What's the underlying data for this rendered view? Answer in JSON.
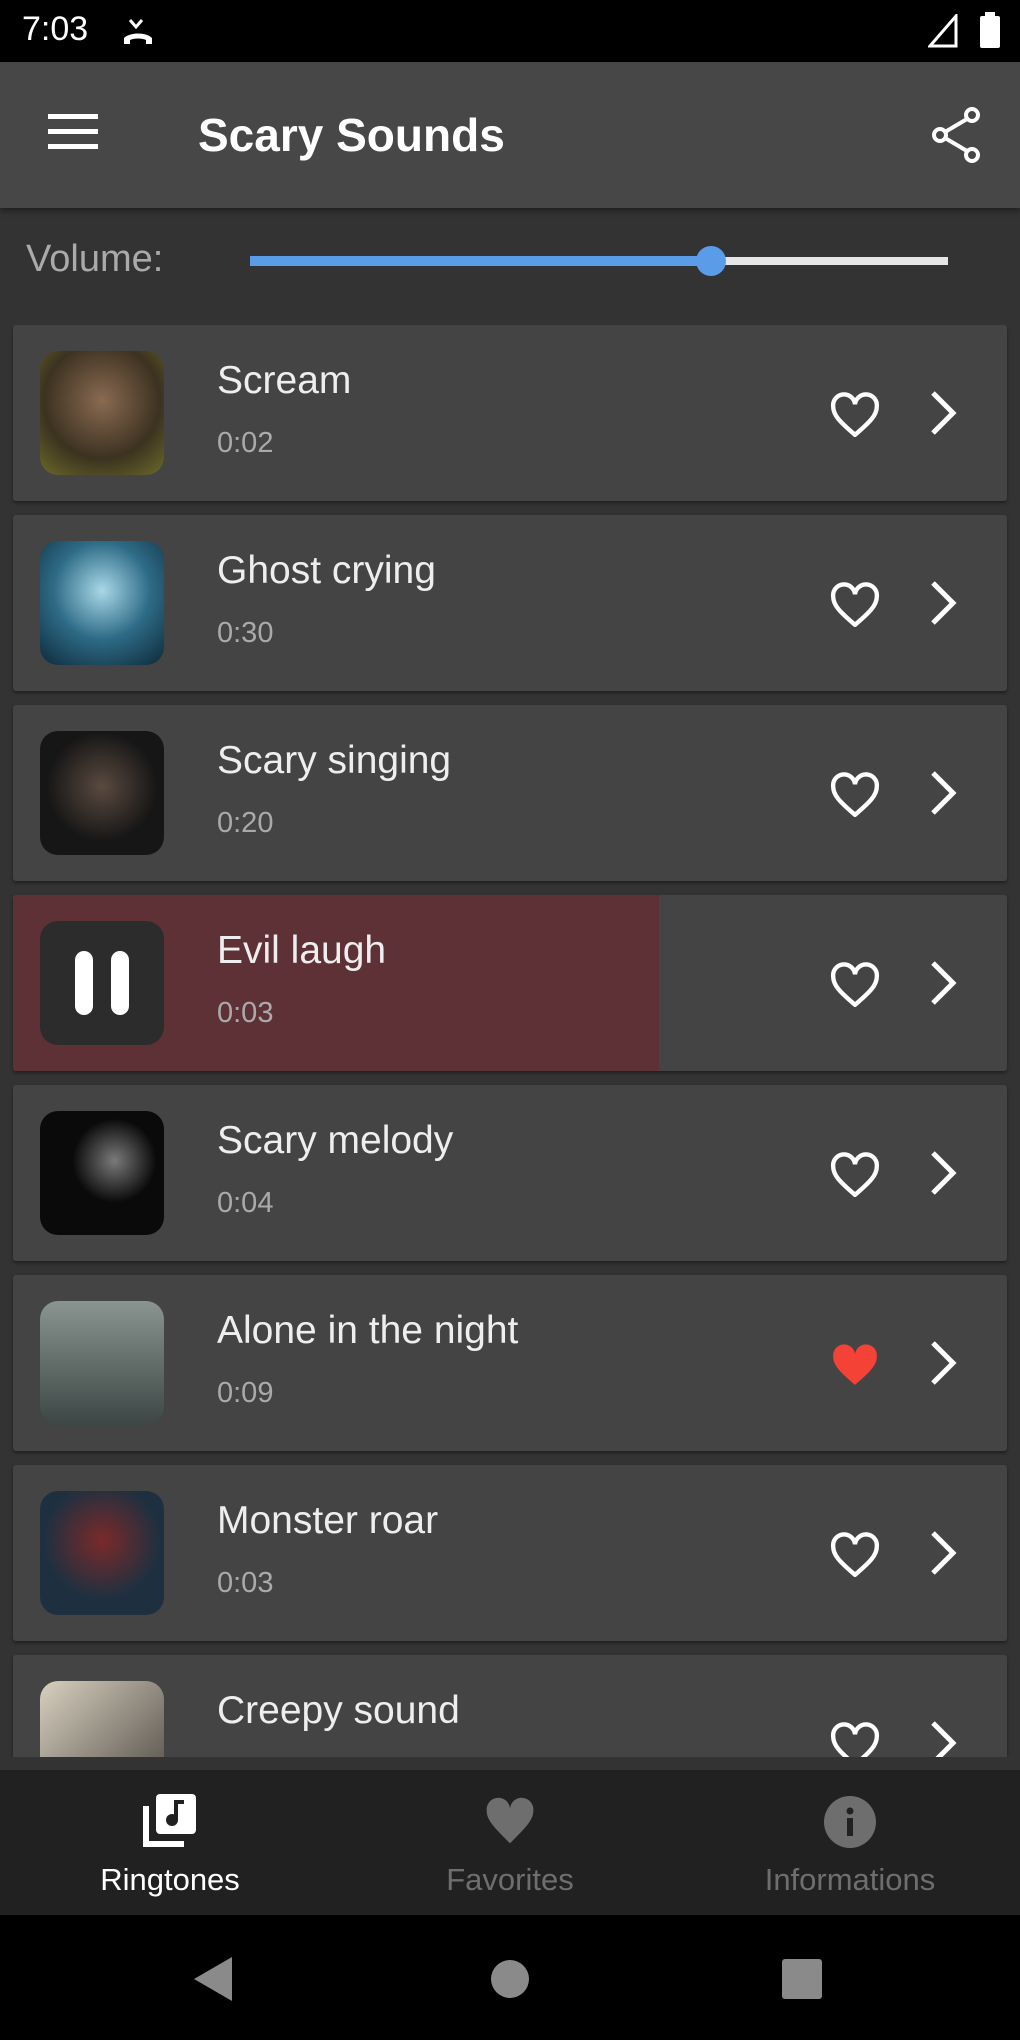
{
  "status_bar": {
    "time": "7:03"
  },
  "app_bar": {
    "title": "Scary Sounds",
    "menu_icon": "menu-icon",
    "share_icon": "share-icon"
  },
  "volume": {
    "label": "Volume:",
    "level": 0.66,
    "color": "#5b9ce8"
  },
  "sounds": [
    {
      "name": "Scream",
      "duration": "0:02",
      "favorite": false,
      "playing": false
    },
    {
      "name": "Ghost crying",
      "duration": "0:30",
      "favorite": false,
      "playing": false
    },
    {
      "name": "Scary singing",
      "duration": "0:20",
      "favorite": false,
      "playing": false
    },
    {
      "name": "Evil laugh",
      "duration": "0:03",
      "favorite": false,
      "playing": true,
      "progress": 0.65
    },
    {
      "name": "Scary melody",
      "duration": "0:04",
      "favorite": false,
      "playing": false
    },
    {
      "name": "Alone in the night",
      "duration": "0:09",
      "favorite": true,
      "playing": false
    },
    {
      "name": "Monster roar",
      "duration": "0:03",
      "favorite": false,
      "playing": false
    },
    {
      "name": "Creepy sound",
      "duration": "",
      "favorite": false,
      "playing": false
    }
  ],
  "bottom_nav": {
    "items": [
      {
        "label": "Ringtones",
        "icon": "music-library-icon",
        "active": true
      },
      {
        "label": "Favorites",
        "icon": "heart-icon",
        "active": false
      },
      {
        "label": "Informations",
        "icon": "info-icon",
        "active": false
      }
    ]
  },
  "colors": {
    "favorite": "#f44336",
    "progress": "#5e3137",
    "app_bar": "#474747"
  }
}
